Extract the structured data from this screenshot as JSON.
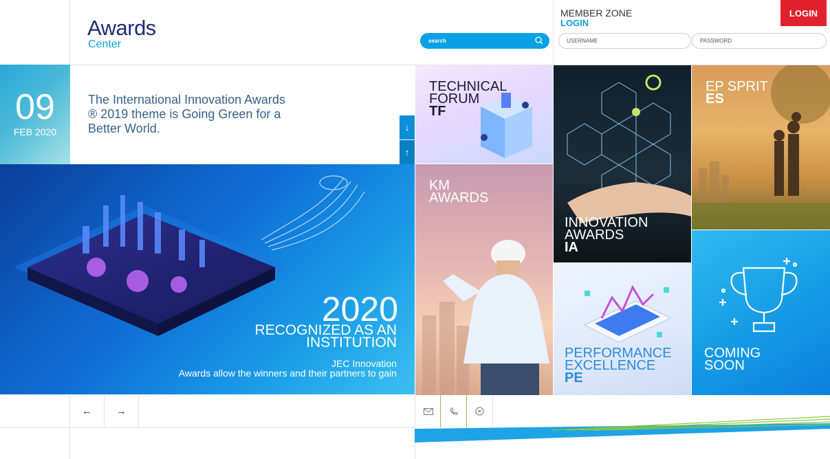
{
  "header": {
    "logo_main": "Awards",
    "logo_sub": "Center",
    "search_placeholder": "search"
  },
  "member_zone": {
    "title": "MEMBER ZONE",
    "subtitle": "LOGIN",
    "login_button": "LOGIN",
    "username_placeholder": "USERNAME",
    "password_placeholder": "PASSWORD"
  },
  "news": {
    "day": "09",
    "month": "FEB 2020",
    "text": "The International Innovation Awards ® 2019 theme is Going Green for a Better World.",
    "down_arrow": "↓",
    "up_arrow": "↑"
  },
  "hero": {
    "year": "2020",
    "line1": "RECOGNIZED AS AN",
    "line2": "INSTITUTION",
    "desc1": "JEC Innovation",
    "desc2": "Awards allow the winners and their partners to gain"
  },
  "tiles": {
    "tf": {
      "line1": "TECHNICAL",
      "line2": "FORUM",
      "abbr": "TF"
    },
    "km": {
      "line1": "KM",
      "line2": "AWARDS"
    },
    "ia": {
      "line1": "INNOVATION",
      "line2": "AWARDS",
      "abbr": "IA"
    },
    "es": {
      "line1": "EP SPRIT",
      "abbr": "ES"
    },
    "pe": {
      "line1": "PERFORMANCE",
      "line2": "EXCELLENCE",
      "abbr": "PE"
    },
    "cs": {
      "line1": "COMING",
      "line2": "SOON"
    }
  },
  "footer": {
    "prev": "←",
    "next": "→"
  },
  "colors": {
    "brand_blue": "#1f2a7a",
    "accent_blue": "#0aa0dd",
    "login_red": "#e3202e",
    "footer_green": "#8cc63f"
  }
}
